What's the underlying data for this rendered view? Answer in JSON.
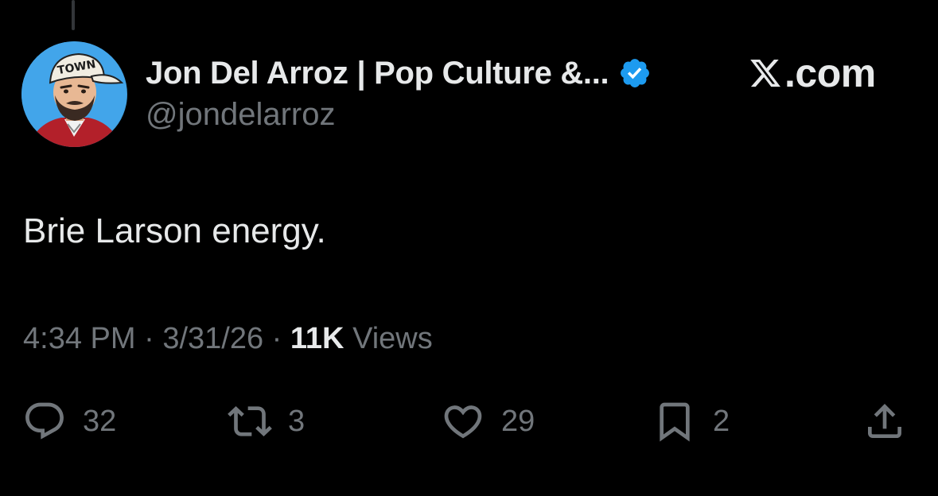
{
  "author": {
    "display_name": "Jon Del Arroz | Pop Culture &...",
    "handle": "@jondelarroz",
    "verified": true,
    "avatar_cap_text": "TOWN"
  },
  "brand": {
    "text": ".com",
    "icon": "x-logo-icon"
  },
  "tweet": {
    "text": "Brie Larson energy."
  },
  "meta": {
    "time": "4:34 PM",
    "separator": " · ",
    "date": "3/31/26",
    "views_count": "11K",
    "views_label": " Views"
  },
  "actions": {
    "replies": "32",
    "reposts": "3",
    "likes": "29",
    "bookmarks": "2"
  },
  "colors": {
    "background": "#000000",
    "primary_text": "#e7e9ea",
    "secondary_text": "#71767b",
    "verified_blue": "#1d9bf0"
  }
}
